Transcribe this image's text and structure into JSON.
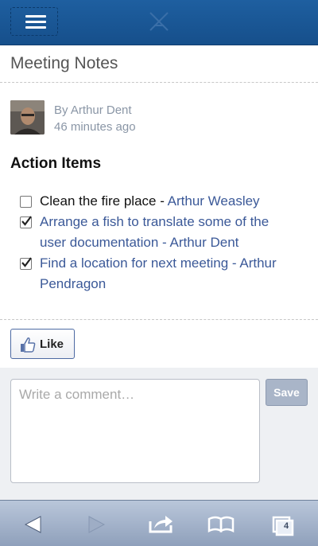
{
  "header": {
    "menu_icon": "hamburger-icon",
    "logo_icon": "app-logo-icon"
  },
  "page": {
    "title": "Meeting Notes"
  },
  "post": {
    "author": "By Arthur Dent",
    "time": "46 minutes ago",
    "avatar_icon": "user-avatar"
  },
  "action_items": {
    "heading": "Action Items",
    "items": [
      {
        "checked": false,
        "text": "Clean the fire place - ",
        "assignee": "Arthur Weasley"
      },
      {
        "checked": true,
        "line1": "Arrange a fish to translate some of the",
        "line2": "user documentation - Arthur Dent"
      },
      {
        "checked": true,
        "line1_text": "Find a location for next meeting - ",
        "line1_assignee": "Arthur",
        "line2_assignee": "Pendragon"
      }
    ]
  },
  "like": {
    "label": "Like",
    "icon": "thumbs-up-icon"
  },
  "comment": {
    "placeholder": "Write a comment…",
    "save_label": "Save"
  },
  "browser": {
    "back_icon": "back-arrow-icon",
    "forward_icon": "forward-arrow-icon",
    "share_icon": "share-icon",
    "bookmarks_icon": "bookmarks-icon",
    "tabs_icon": "tabs-icon",
    "tabs_count": "4"
  },
  "colors": {
    "header": "#1a5795",
    "link": "#3b5998",
    "toolbar": "#a3b2c9"
  }
}
